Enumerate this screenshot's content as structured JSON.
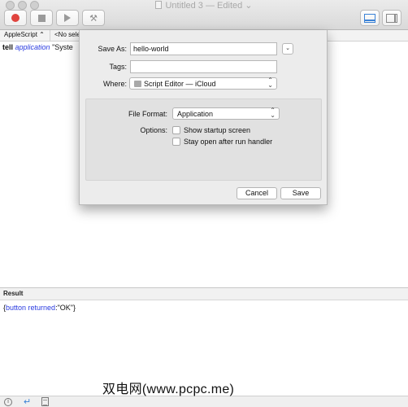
{
  "window": {
    "title": "Untitled 3",
    "edited_label": "— Edited ⌄"
  },
  "navigation": {
    "language_selector": "AppleScript ⌃",
    "element_selector": "<No sele"
  },
  "editor": {
    "keyword": "tell",
    "app_token": "application",
    "string_fragment": "\"Syste"
  },
  "save_sheet": {
    "save_as_label": "Save As:",
    "save_as_value": "hello-world",
    "tags_label": "Tags:",
    "tags_value": "",
    "where_label": "Where:",
    "where_value": "Script Editor — iCloud",
    "file_format_label": "File Format:",
    "file_format_value": "Application",
    "options_label": "Options:",
    "options": [
      {
        "label": "Show startup screen",
        "checked": false
      },
      {
        "label": "Stay open after run handler",
        "checked": false
      }
    ],
    "cancel_label": "Cancel",
    "save_label": "Save"
  },
  "result": {
    "header": "Result",
    "text_open": "{",
    "text_key": "button returned",
    "text_rest": ":\"OK\"}"
  },
  "watermark": "双电网(www.pcpc.me)",
  "colors": {
    "record_red": "#e0443e",
    "accent_blue": "#3b82d6",
    "syntax_blue": "#2a3be0"
  }
}
